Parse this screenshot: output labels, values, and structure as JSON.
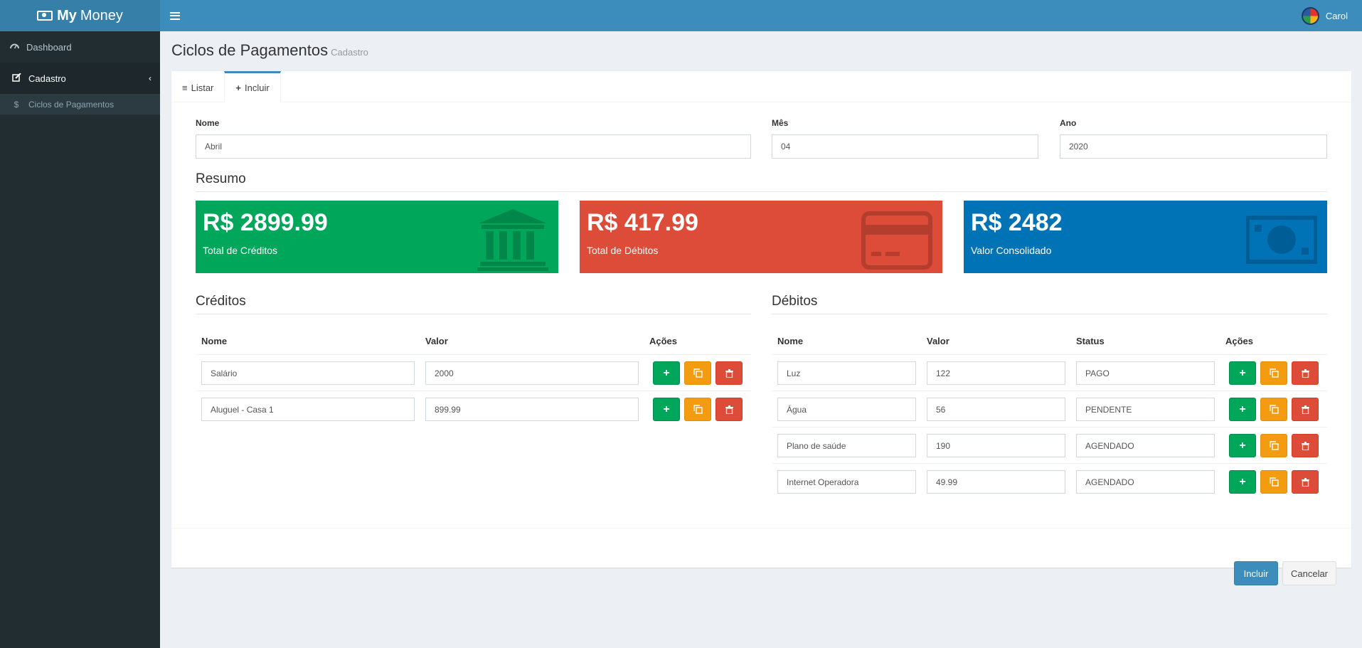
{
  "app": {
    "logo_bold": "My",
    "logo_rest": "Money",
    "user_name": "Carol"
  },
  "sidebar": {
    "items": [
      {
        "label": "Dashboard",
        "icon": "dashboard-icon"
      },
      {
        "label": "Cadastro",
        "icon": "edit-icon"
      }
    ],
    "subitems": [
      {
        "label": "Ciclos de Pagamentos",
        "icon": "dollar-icon"
      }
    ]
  },
  "page": {
    "title": "Ciclos de Pagamentos",
    "subtitle": "Cadastro"
  },
  "tabs": [
    {
      "label": "Listar",
      "icon": "list-icon"
    },
    {
      "label": "Incluir",
      "icon": "plus-icon"
    }
  ],
  "form": {
    "name_label": "Nome",
    "name_value": "Abril",
    "month_label": "Mês",
    "month_value": "04",
    "year_label": "Ano",
    "year_value": "2020"
  },
  "summary": {
    "title": "Resumo",
    "credit_amount": "R$ 2899.99",
    "credit_caption": "Total de Créditos",
    "debit_amount": "R$ 417.99",
    "debit_caption": "Total de Débitos",
    "consolidated_amount": "R$ 2482",
    "consolidated_caption": "Valor Consolidado",
    "colors": {
      "credit": "#00a65a",
      "debit": "#dd4b39",
      "consolidated": "#0073b7"
    }
  },
  "credits": {
    "title": "Créditos",
    "headers": [
      "Nome",
      "Valor",
      "Ações"
    ],
    "rows": [
      {
        "name": "Salário",
        "value": "2000"
      },
      {
        "name": "Aluguel - Casa 1",
        "value": "899.99"
      }
    ]
  },
  "debits": {
    "title": "Débitos",
    "headers": [
      "Nome",
      "Valor",
      "Status",
      "Ações"
    ],
    "rows": [
      {
        "name": "Luz",
        "value": "122",
        "status": "PAGO"
      },
      {
        "name": "Água",
        "value": "56",
        "status": "PENDENTE"
      },
      {
        "name": "Plano de saúde",
        "value": "190",
        "status": "AGENDADO"
      },
      {
        "name": "Internet Operadora",
        "value": "49.99",
        "status": "AGENDADO"
      }
    ]
  },
  "actions": {
    "submit_label": "Incluir",
    "cancel_label": "Cancelar"
  }
}
